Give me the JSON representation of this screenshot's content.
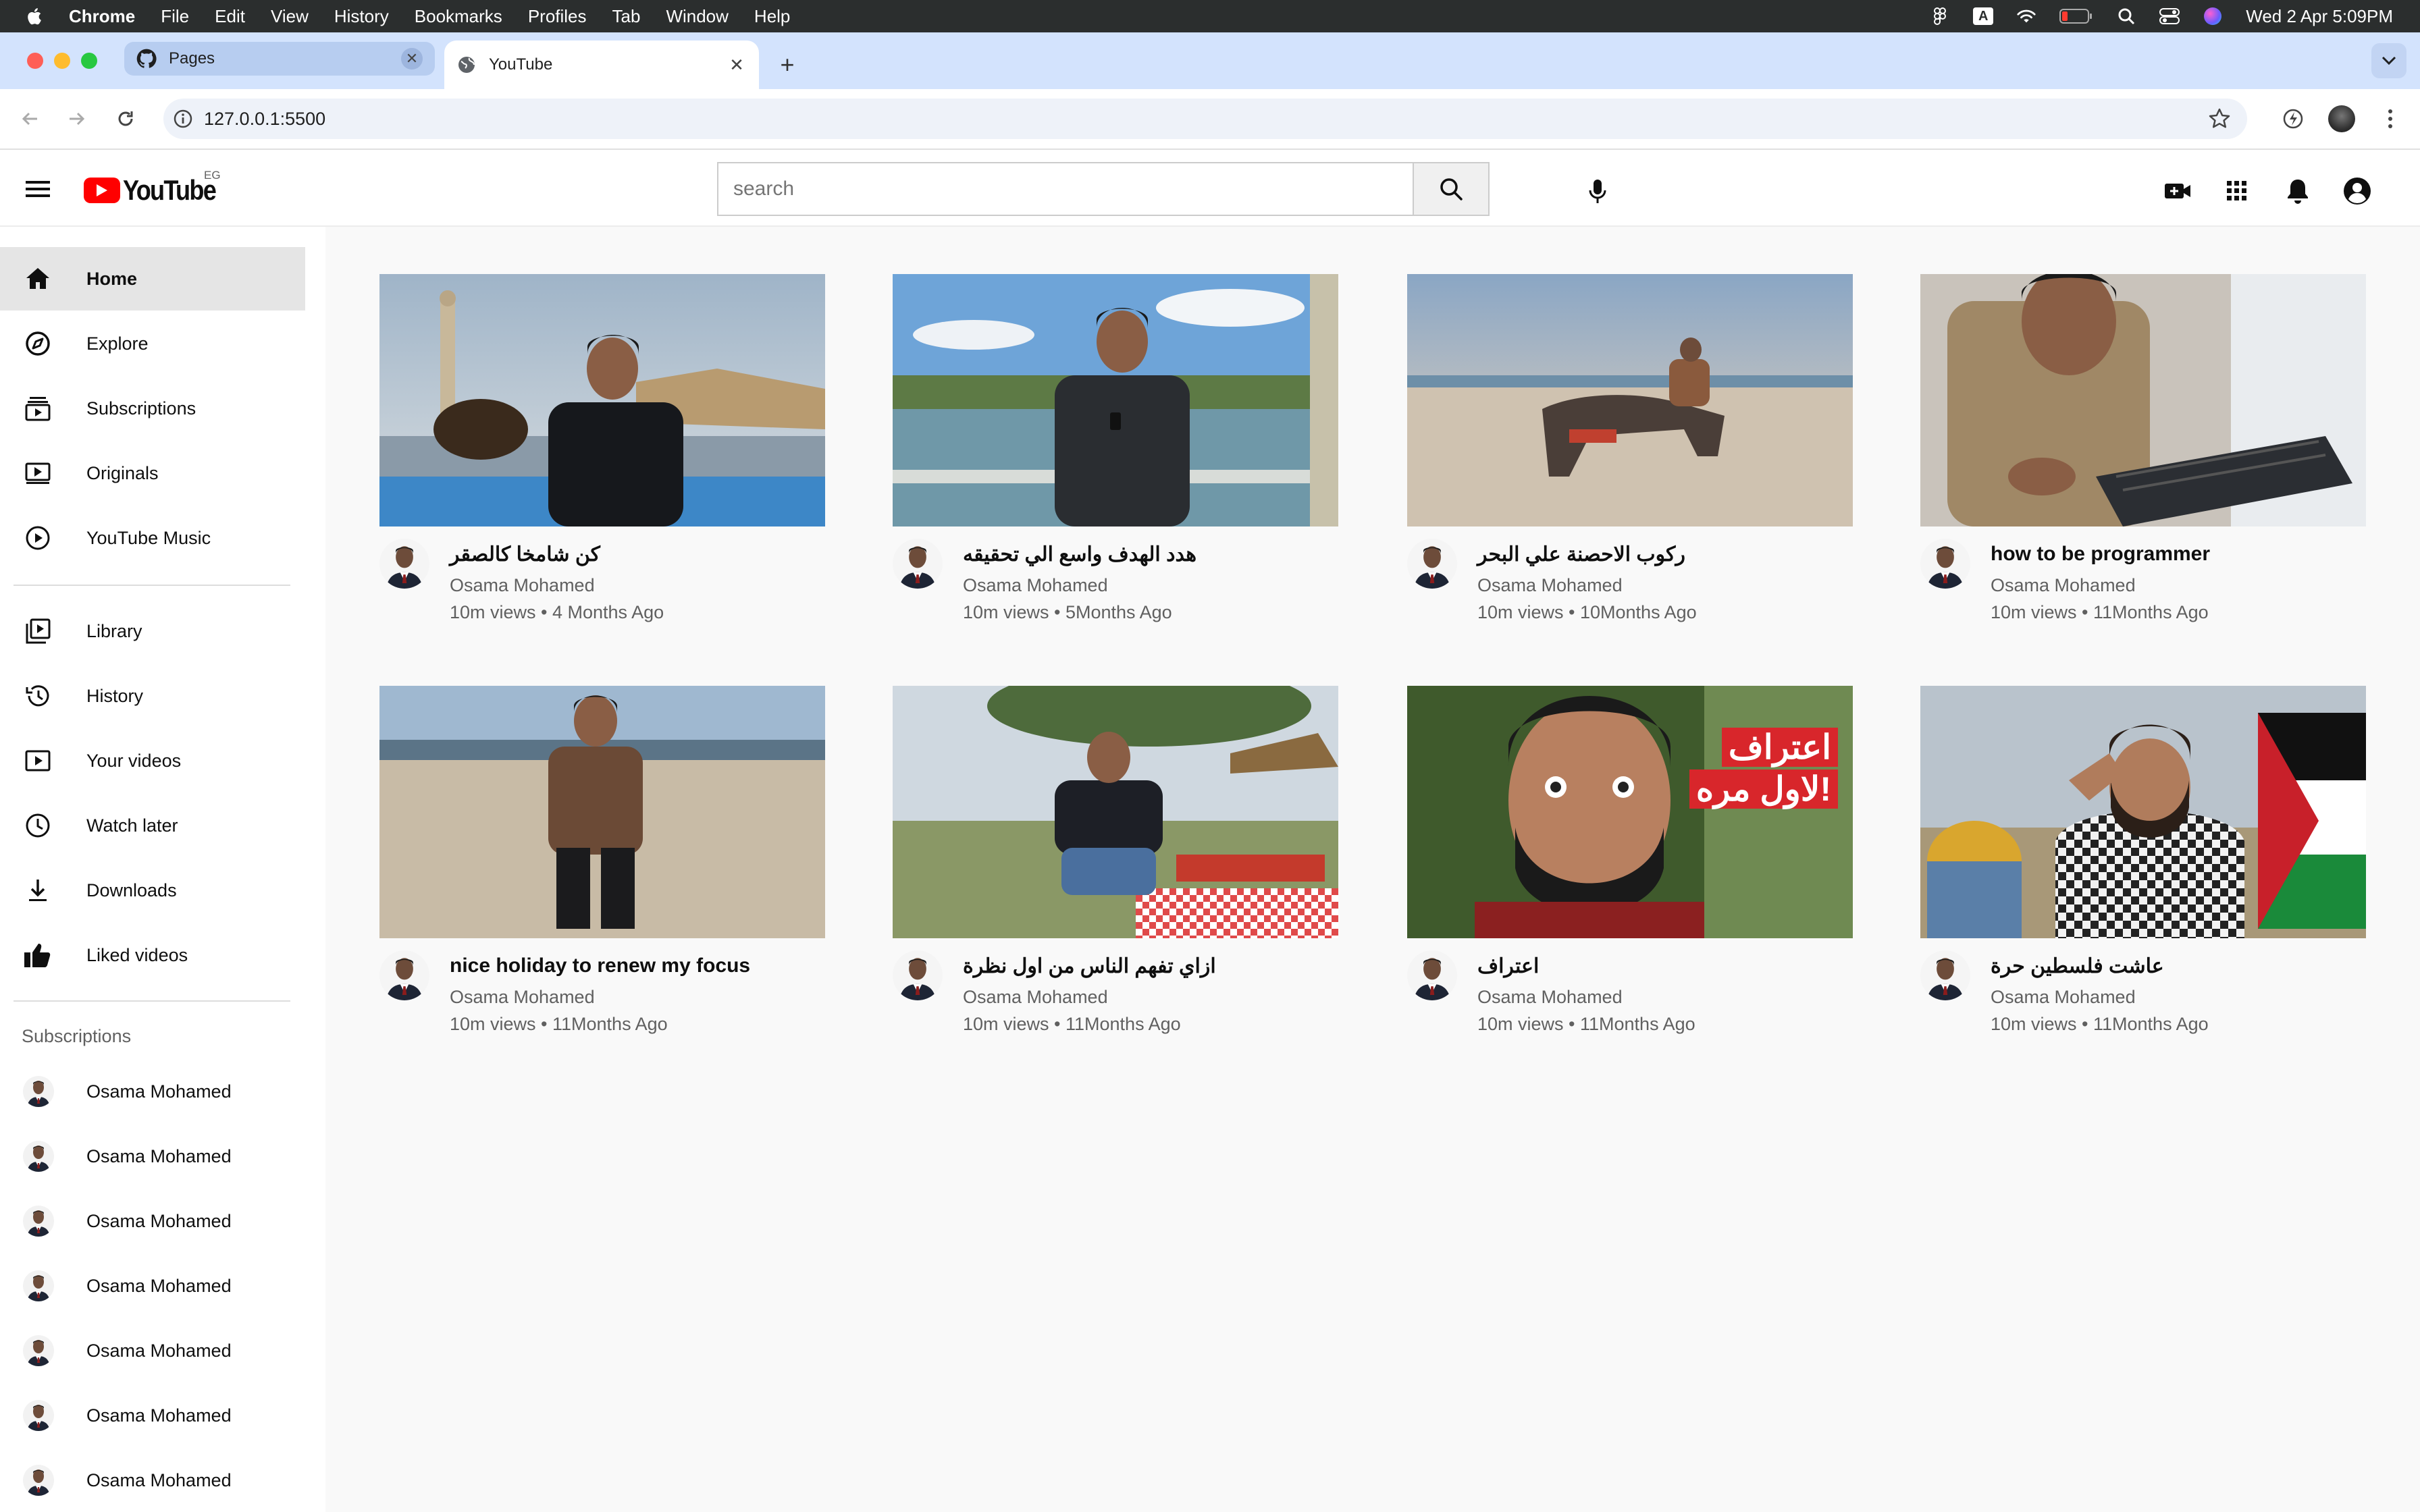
{
  "os_menu": {
    "app_name": "Chrome",
    "items": [
      "File",
      "Edit",
      "View",
      "History",
      "Bookmarks",
      "Profiles",
      "Tab",
      "Window",
      "Help"
    ],
    "clock": "Wed 2 Apr  5:09PM"
  },
  "browser": {
    "tabs": [
      {
        "title": "Pages",
        "icon": "github-icon",
        "active": false
      },
      {
        "title": "YouTube",
        "icon": "globe-icon",
        "active": true
      }
    ],
    "url": "127.0.0.1:5500"
  },
  "youtube": {
    "logo_text": "YouTube",
    "country_code": "EG",
    "search_placeholder": "search",
    "sidebar": {
      "main": [
        "Home",
        "Explore",
        "Subscriptions",
        "Originals",
        "YouTube Music"
      ],
      "library": [
        "Library",
        "History",
        "Your videos",
        "Watch later",
        "Downloads",
        "Liked videos"
      ],
      "subscriptions_heading": "Subscriptions",
      "subscriptions": [
        "Osama Mohamed",
        "Osama Mohamed",
        "Osama Mohamed",
        "Osama Mohamed",
        "Osama Mohamed",
        "Osama Mohamed",
        "Osama Mohamed"
      ]
    },
    "videos": [
      {
        "title": "كن شامخا كالصقر",
        "channel": "Osama Mohamed",
        "meta": "10m views • 4 Months Ago"
      },
      {
        "title": "هدد الهدف واسع الي تحقيقه",
        "channel": "Osama Mohamed",
        "meta": "10m views • 5Months Ago"
      },
      {
        "title": "ركوب الاحصنة علي البحر",
        "channel": "Osama Mohamed",
        "meta": "10m views • 10Months Ago"
      },
      {
        "title": "how to be programmer",
        "channel": "Osama Mohamed",
        "meta": "10m views • 11Months Ago"
      },
      {
        "title": "nice holiday to renew my focus",
        "channel": "Osama Mohamed",
        "meta": "10m views • 11Months Ago"
      },
      {
        "title": "ازاي تفهم الناس من اول نظرة",
        "channel": "Osama Mohamed",
        "meta": "10m views • 11Months Ago"
      },
      {
        "title": "اعتراف",
        "channel": "Osama Mohamed",
        "meta": "10m views • 11Months Ago",
        "overlay": [
          "اعتراف",
          "لاول مره!"
        ]
      },
      {
        "title": "عاشت فلسطين حرة",
        "channel": "Osama Mohamed",
        "meta": "10m views • 11Months Ago"
      }
    ]
  }
}
